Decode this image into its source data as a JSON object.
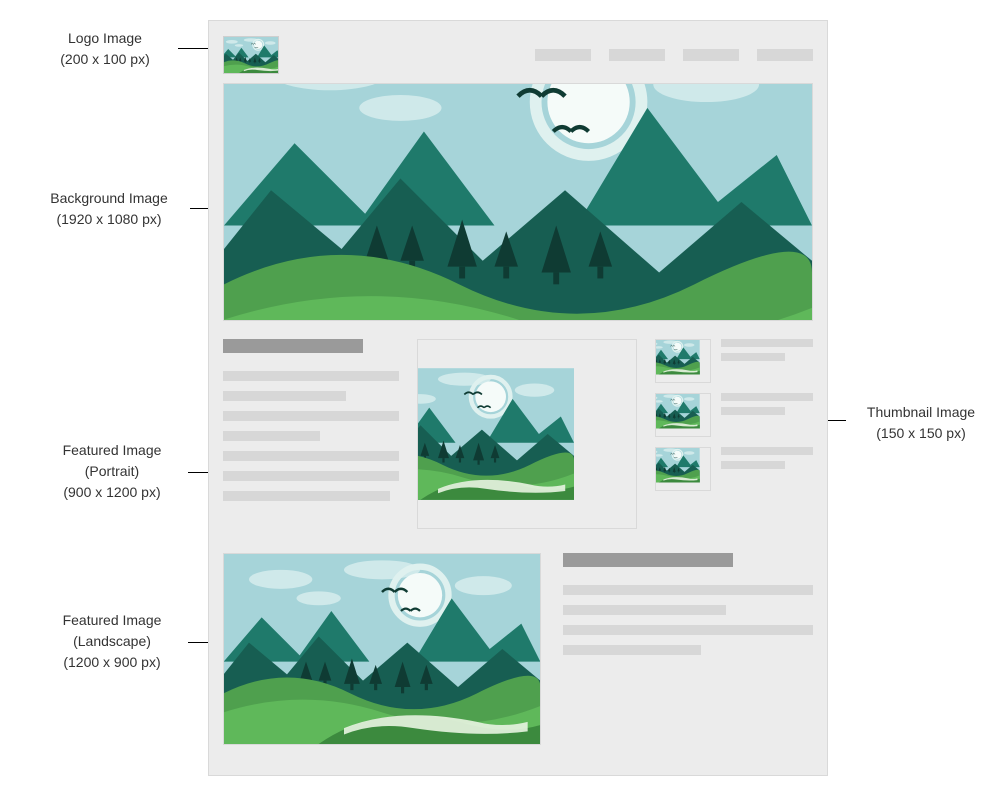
{
  "callouts": {
    "logo": {
      "title": "Logo Image",
      "dims": "(200 x 100 px)"
    },
    "background": {
      "title": "Background Image",
      "dims": "(1920 x 1080 px)"
    },
    "portrait": {
      "title": "Featured Image",
      "subtitle": "(Portrait)",
      "dims": "(900 x 1200 px)"
    },
    "landscape": {
      "title": "Featured Image",
      "subtitle": "(Landscape)",
      "dims": "(1200 x 900 px)"
    },
    "thumbnail": {
      "title": "Thumbnail Image",
      "dims": "(150 x 150 px)"
    }
  }
}
